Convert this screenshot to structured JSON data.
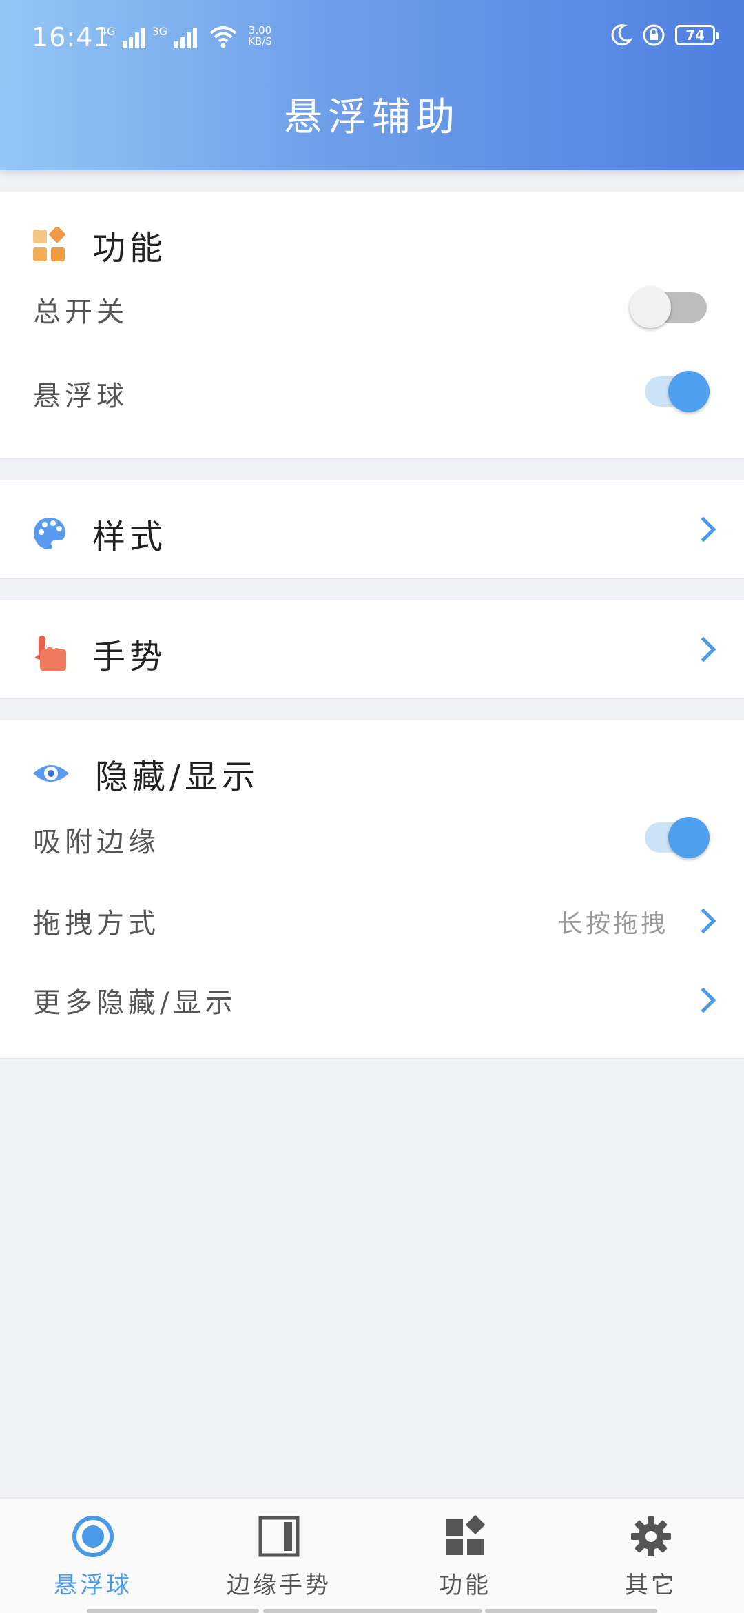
{
  "status_bar": {
    "time": "16:41",
    "network_1": "4G",
    "network_2": "3G",
    "speed_value": "3.00",
    "speed_unit": "KB/S",
    "battery": "74"
  },
  "header": {
    "title": "悬浮辅助"
  },
  "sections": {
    "features": {
      "title": "功能",
      "rows": [
        {
          "label": "总开关",
          "toggle": false
        },
        {
          "label": "悬浮球",
          "toggle": true
        }
      ]
    },
    "style": {
      "title": "样式"
    },
    "gesture": {
      "title": "手势"
    },
    "hide_show": {
      "title": "隐藏/显示",
      "rows": [
        {
          "label": "吸附边缘",
          "toggle": true
        },
        {
          "label": "拖拽方式",
          "value": "长按拖拽"
        },
        {
          "label": "更多隐藏/显示"
        }
      ]
    }
  },
  "bottom_nav": {
    "items": [
      {
        "label": "悬浮球",
        "icon": "floating-ball-icon",
        "active": true
      },
      {
        "label": "边缘手势",
        "icon": "edge-gesture-icon",
        "active": false
      },
      {
        "label": "功能",
        "icon": "features-icon",
        "active": false
      },
      {
        "label": "其它",
        "icon": "settings-icon",
        "active": false
      }
    ]
  },
  "colors": {
    "accent": "#4a9aea",
    "header_start": "#93c6f5",
    "header_end": "#4f7fdf",
    "background": "#f1f2f6"
  }
}
